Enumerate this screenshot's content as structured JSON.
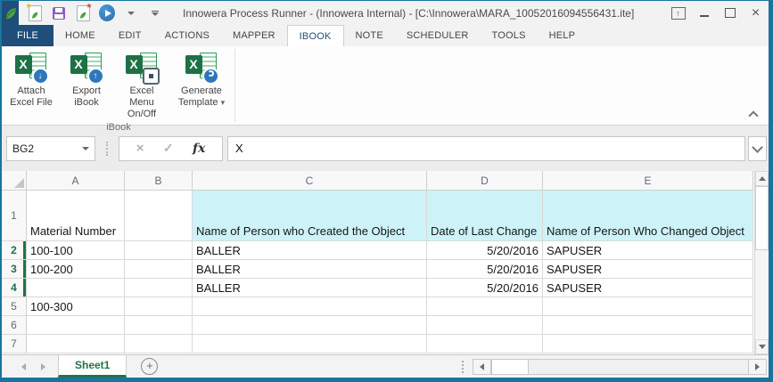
{
  "colors": {
    "excel_green": "#1e7145",
    "accent_green": "#217346",
    "tab_blue": "#1e4e79",
    "badge_blue": "#2e77bc",
    "highlight_cyan": "#cdf3f9",
    "window_border_teal": "#19759c"
  },
  "title_bar": {
    "title": "Innowera Process Runner - (Innowera Internal) - [C:\\Innowera\\MARA_10052016094556431.ite]"
  },
  "ribbon_tabs": {
    "active": "IBOOK",
    "items": [
      {
        "label": "FILE"
      },
      {
        "label": "HOME"
      },
      {
        "label": "EDIT"
      },
      {
        "label": "ACTIONS"
      },
      {
        "label": "MAPPER"
      },
      {
        "label": "IBOOK"
      },
      {
        "label": "NOTE"
      },
      {
        "label": "SCHEDULER"
      },
      {
        "label": "TOOLS"
      },
      {
        "label": "HELP"
      }
    ]
  },
  "ribbon": {
    "group_label": "iBook",
    "buttons": [
      {
        "line1": "Attach",
        "line2": "Excel File",
        "badge_icon": "download-arrow",
        "badge_glyph": "↓"
      },
      {
        "line1": "Export",
        "line2": "iBook",
        "badge_icon": "upload-arrow",
        "badge_glyph": "↑"
      },
      {
        "line1": "Excel Menu",
        "line2": "On/Off",
        "badge_icon": "toggle"
      },
      {
        "line1": "Generate",
        "line2": "Template",
        "badge_icon": "refresh",
        "caret": "▾"
      }
    ]
  },
  "formula_bar": {
    "name_box": "BG2",
    "cancel": "×",
    "confirm": "✓",
    "fx": "fx",
    "formula": "X"
  },
  "grid": {
    "columns": [
      "A",
      "B",
      "C",
      "D",
      "E"
    ],
    "rows": [
      {
        "n": "1",
        "a": "Material Number",
        "b": "",
        "c": "Name of Person who Created the Object",
        "d": "Date of Last Change",
        "e": "Name of Person Who Changed Object",
        "processed": false
      },
      {
        "n": "2",
        "a": "100-100",
        "b": "",
        "c": "BALLER",
        "d": "5/20/2016",
        "e": "SAPUSER",
        "processed": true
      },
      {
        "n": "3",
        "a": "100-200",
        "b": "",
        "c": "BALLER",
        "d": "5/20/2016",
        "e": "SAPUSER",
        "processed": true
      },
      {
        "n": "4",
        "a": "",
        "b": "",
        "c": "BALLER",
        "d": "5/20/2016",
        "e": "SAPUSER",
        "processed": true
      },
      {
        "n": "5",
        "a": "100-300",
        "b": "",
        "c": "",
        "d": "",
        "e": "",
        "processed": false
      },
      {
        "n": "6",
        "a": "",
        "b": "",
        "c": "",
        "d": "",
        "e": "",
        "processed": false
      },
      {
        "n": "7",
        "a": "",
        "b": "",
        "c": "",
        "d": "",
        "e": "",
        "processed": false
      }
    ]
  },
  "sheet_bar": {
    "sheet_name": "Sheet1",
    "add_label": "+"
  },
  "glyphs": {
    "x_letter": "X",
    "ribbon_display": "↑",
    "minimize": "–",
    "close": "×",
    "star": "★"
  }
}
